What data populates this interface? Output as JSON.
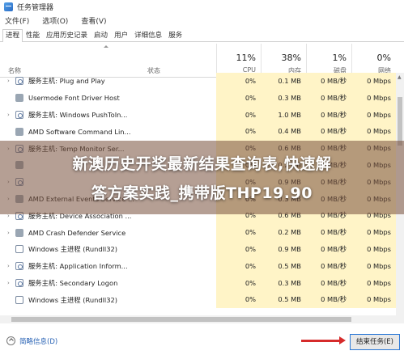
{
  "window": {
    "title": "任务管理器"
  },
  "menu": [
    "文件(F)",
    "选项(O)",
    "查看(V)"
  ],
  "tabs": [
    {
      "label": "进程",
      "active": true
    },
    {
      "label": "性能",
      "active": false
    },
    {
      "label": "应用历史记录",
      "active": false
    },
    {
      "label": "启动",
      "active": false
    },
    {
      "label": "用户",
      "active": false
    },
    {
      "label": "详细信息",
      "active": false
    },
    {
      "label": "服务",
      "active": false
    }
  ],
  "columns": {
    "name": "名称",
    "status": "状态",
    "cpu": {
      "percent": "11%",
      "label": "CPU"
    },
    "memory": {
      "percent": "38%",
      "label": "内存"
    },
    "disk": {
      "percent": "1%",
      "label": "磁盘"
    },
    "network": {
      "percent": "0%",
      "label": "网络"
    }
  },
  "rows": [
    {
      "name": "服务主机: Plug and Play",
      "icon": "service-host-icon",
      "expandable": true,
      "cpu": "0%",
      "memory": "0.1 MB",
      "disk": "0 MB/秒",
      "network": "0 Mbps"
    },
    {
      "name": "Usermode Font Driver Host",
      "icon": "app-icon",
      "expandable": false,
      "cpu": "0%",
      "memory": "0.3 MB",
      "disk": "0 MB/秒",
      "network": "0 Mbps"
    },
    {
      "name": "服务主机: Windows PushToIn...",
      "icon": "service-host-icon",
      "expandable": true,
      "cpu": "0%",
      "memory": "1.0 MB",
      "disk": "0 MB/秒",
      "network": "0 Mbps"
    },
    {
      "name": "AMD Software Command Lin...",
      "icon": "app-icon",
      "expandable": false,
      "cpu": "0%",
      "memory": "0.4 MB",
      "disk": "0 MB/秒",
      "network": "0 Mbps"
    },
    {
      "name": "服务主机: Temp Monitor Ser...",
      "icon": "service-host-icon",
      "expandable": true,
      "cpu": "0%",
      "memory": "0.6 MB",
      "disk": "0 MB/秒",
      "network": "0 Mbps"
    },
    {
      "name": "",
      "icon": "app-icon",
      "expandable": false,
      "cpu": "0%",
      "memory": "0.2 MB",
      "disk": "0 MB/秒",
      "network": "0 Mbps"
    },
    {
      "name": "",
      "icon": "service-host-icon",
      "expandable": true,
      "cpu": "0%",
      "memory": "0.9 MB",
      "disk": "0 MB/秒",
      "network": "0 Mbps"
    },
    {
      "name": "AMD External Events Service ...",
      "icon": "app-icon",
      "expandable": true,
      "cpu": "0%",
      "memory": "0.3 MB",
      "disk": "0 MB/秒",
      "network": "0 Mbps"
    },
    {
      "name": "服务主机: Device Association ...",
      "icon": "service-host-icon",
      "expandable": true,
      "cpu": "0%",
      "memory": "0.6 MB",
      "disk": "0 MB/秒",
      "network": "0 Mbps"
    },
    {
      "name": "AMD Crash Defender Service",
      "icon": "app-icon",
      "expandable": true,
      "cpu": "0%",
      "memory": "0.2 MB",
      "disk": "0 MB/秒",
      "network": "0 Mbps"
    },
    {
      "name": "Windows 主进程 (Rundll32)",
      "icon": "window-icon",
      "expandable": false,
      "cpu": "0%",
      "memory": "0.9 MB",
      "disk": "0 MB/秒",
      "network": "0 Mbps"
    },
    {
      "name": "服务主机: Application Inform...",
      "icon": "service-host-icon",
      "expandable": true,
      "cpu": "0%",
      "memory": "0.5 MB",
      "disk": "0 MB/秒",
      "network": "0 Mbps"
    },
    {
      "name": "服务主机: Secondary Logon",
      "icon": "service-host-icon",
      "expandable": true,
      "cpu": "0%",
      "memory": "0.3 MB",
      "disk": "0 MB/秒",
      "network": "0 Mbps"
    },
    {
      "name": "Windows 主进程 (Rundll32)",
      "icon": "window-icon",
      "expandable": false,
      "cpu": "0%",
      "memory": "0.5 MB",
      "disk": "0 MB/秒",
      "network": "0 Mbps"
    }
  ],
  "footer": {
    "fewer_details": "简略信息(D)",
    "end_task": "结束任务(E)"
  },
  "overlay": {
    "line1": "新澳历史开奖最新结果查询表,快速解",
    "line2": "答方案实践_携带版THP19.90"
  },
  "colors": {
    "highlight": "#fff4c7",
    "accent_blue": "#2d79d6",
    "arrow_red": "#d62b2b"
  }
}
